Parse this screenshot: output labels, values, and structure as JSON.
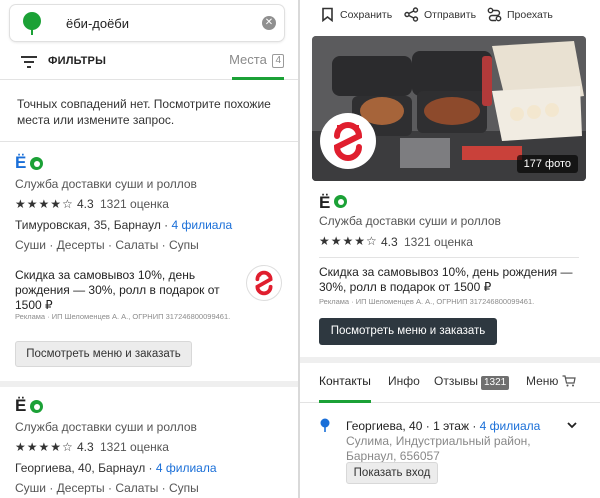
{
  "search": {
    "query": "ёби-доёби"
  },
  "filters": {
    "label": "ФИЛЬТРЫ",
    "tab_label": "Места",
    "tab_count": "4"
  },
  "no_match": "Точных совпадений нет. Посмотрите похожие места или измените запрос.",
  "results": [
    {
      "title": "Ё",
      "category": "Служба доставки суши и роллов",
      "stars": "★★★★☆",
      "rating": "4.3",
      "reviews": "1321 оценка",
      "address": "Тимуровская, 35, Барнаул · ",
      "branches": "4 филиала",
      "tags": "Суши · Десерты · Салаты · Супы",
      "ad_text": "Скидка за самовывоз 10%, день рождения — 30%, ролл в подарок от 1500 ₽",
      "ad_small": "Реклама · ИП Шеломенцев А. А., ОГРНИП 317246800099461.",
      "ad_button": "Посмотреть меню и заказать"
    },
    {
      "title": "Ё",
      "category": "Служба доставки суши и роллов",
      "stars": "★★★★☆",
      "rating": "4.3",
      "reviews": "1321 оценка",
      "address": "Георгиева, 40, Барнаул · ",
      "branches": "4 филиала",
      "tags": "Суши · Десерты · Салаты · Супы"
    }
  ],
  "detail": {
    "actions": {
      "save": "Сохранить",
      "share": "Отправить",
      "route": "Проехать"
    },
    "photo_count": "177 фото",
    "title": "Ё",
    "category": "Служба доставки суши и роллов",
    "stars": "★★★★☆",
    "rating": "4.3",
    "reviews": "1321 оценка",
    "ad_text": "Скидка за самовывоз 10%, день рождения — 30%, ролл в подарок от 1500 ₽",
    "ad_small": "Реклама · ИП Шеломенцев А. А., ОГРНИП 317246800099461.",
    "ad_button": "Посмотреть меню и заказать",
    "tabs": {
      "contacts": "Контакты",
      "info": "Инфо",
      "reviews": "Отзывы",
      "reviews_count": "1321",
      "menu": "Меню"
    },
    "address_main": "Георгиева, 40 · 1 этаж · ",
    "address_branches": "4 филиала",
    "address_sub": "Сулима, Индустриальный район, Барнаул, 656057",
    "show_entrance": "Показать вход"
  },
  "colors": {
    "accent_green": "#1ba136",
    "link_blue": "#1a6fd8",
    "brand_red": "#e01e2e",
    "dark_button": "#2e3840"
  }
}
